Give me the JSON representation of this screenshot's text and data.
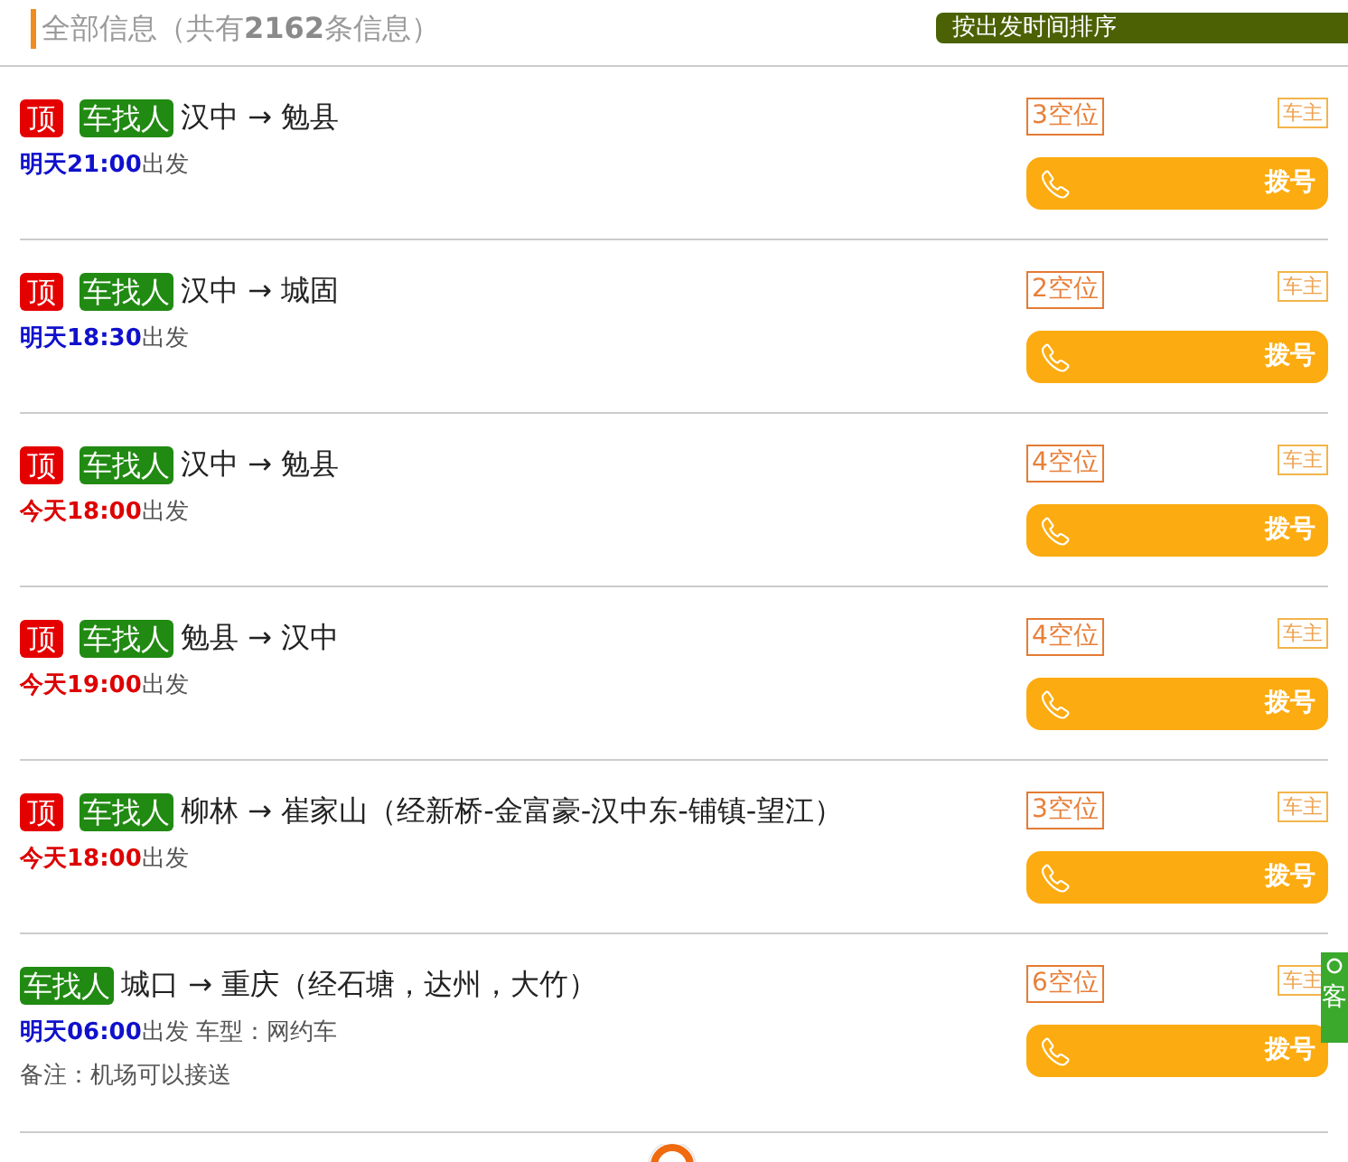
{
  "header": {
    "title": "全部信息（共有**2162**条信息）",
    "sort_button": "按出发时间排序"
  },
  "listings": [
    {
      "tags": [
        {
          "kind": "top",
          "text": "顶"
        },
        {
          "kind": "type",
          "text": "车找人"
        }
      ],
      "route": "汉中 → 勉县",
      "departure": {
        "time": "明天21:00",
        "color": "#1010cc",
        "label": "出发"
      },
      "seats": "3空位",
      "role": "车主",
      "dial_button": "拨号"
    },
    {
      "tags": [
        {
          "kind": "top",
          "text": "顶"
        },
        {
          "kind": "type",
          "text": "车找人"
        }
      ],
      "route": "汉中 → 城固",
      "departure": {
        "time": "明天18:30",
        "color": "#1010cc",
        "label": "出发"
      },
      "seats": "2空位",
      "role": "车主",
      "dial_button": "拨号"
    },
    {
      "tags": [
        {
          "kind": "top",
          "text": "顶"
        },
        {
          "kind": "type",
          "text": "车找人"
        }
      ],
      "route": "汉中 → 勉县",
      "departure": {
        "time": "今天18:00",
        "color": "#dd0000",
        "label": "出发"
      },
      "seats": "4空位",
      "role": "车主",
      "dial_button": "拨号"
    },
    {
      "tags": [
        {
          "kind": "top",
          "text": "顶"
        },
        {
          "kind": "type",
          "text": "车找人"
        }
      ],
      "route": "勉县 → 汉中",
      "departure": {
        "time": "今天19:00",
        "color": "#dd0000",
        "label": "出发"
      },
      "seats": "4空位",
      "role": "车主",
      "dial_button": "拨号"
    },
    {
      "tags": [
        {
          "kind": "top",
          "text": "顶"
        },
        {
          "kind": "type",
          "text": "车找人"
        }
      ],
      "route": "柳林 → 崔家山（经新桥-金富豪-汉中东-铺镇-望江）",
      "departure": {
        "time": "今天18:00",
        "color": "#dd0000",
        "label": "出发"
      },
      "seats": "3空位",
      "role": "车主",
      "dial_button": "拨号"
    },
    {
      "tags": [
        {
          "kind": "type",
          "text": "车找人"
        }
      ],
      "route": "城口 → 重庆（经石塘，达州，大竹）",
      "departure": {
        "time": "明天06:00",
        "color": "#1010cc",
        "label": "出发",
        "car_type": "车型：网约车"
      },
      "remark": "备注：机场可以接送",
      "seats": "6空位",
      "role": "车主",
      "dial_button": "拨号"
    }
  ],
  "service_tab": {
    "label": "客"
  }
}
